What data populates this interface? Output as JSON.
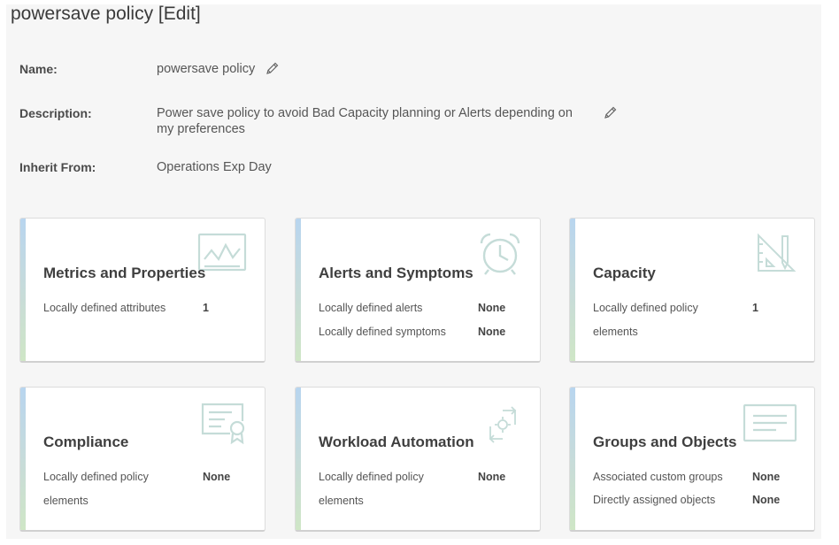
{
  "page": {
    "title": "powersave policy [Edit]"
  },
  "details": {
    "name_label": "Name:",
    "name_value": "powersave policy",
    "description_label": "Description:",
    "description_line1": "Power save policy to avoid Bad Capacity planning or Alerts depending on",
    "description_line2": "my preferences",
    "inherit_label": "Inherit From:",
    "inherit_value": "Operations Exp Day"
  },
  "cards": {
    "metrics": {
      "title": "Metrics and Properties",
      "icon": "chart-monitor-icon",
      "rows": [
        {
          "label": "Locally defined attributes",
          "value": "1"
        }
      ]
    },
    "alerts": {
      "title": "Alerts and Symptoms",
      "icon": "alarm-clock-icon",
      "rows": [
        {
          "label": "Locally defined alerts",
          "value": "None"
        },
        {
          "label": "Locally defined symptoms",
          "value": "None"
        }
      ]
    },
    "capacity": {
      "title": "Capacity",
      "icon": "ruler-pencil-icon",
      "rows": [
        {
          "label_line1": "Locally defined policy",
          "label_line2": "elements",
          "value": "1"
        }
      ]
    },
    "compliance": {
      "title": "Compliance",
      "icon": "certificate-icon",
      "rows": [
        {
          "label_line1": "Locally defined policy",
          "label_line2": "elements",
          "value": "None"
        }
      ]
    },
    "workload": {
      "title": "Workload Automation",
      "icon": "sync-gear-icon",
      "rows": [
        {
          "label_line1": "Locally defined policy",
          "label_line2": "elements",
          "value": "None"
        }
      ]
    },
    "groups": {
      "title": "Groups and Objects",
      "icon": "list-box-icon",
      "rows": [
        {
          "label": "Associated custom groups",
          "value": "None"
        },
        {
          "label": "Directly assigned objects",
          "value": "None"
        }
      ]
    }
  },
  "colors": {
    "icon_tint": "#c5dcd8",
    "accent_top": "#b8d5ef",
    "accent_bottom": "#cfe6c6"
  }
}
